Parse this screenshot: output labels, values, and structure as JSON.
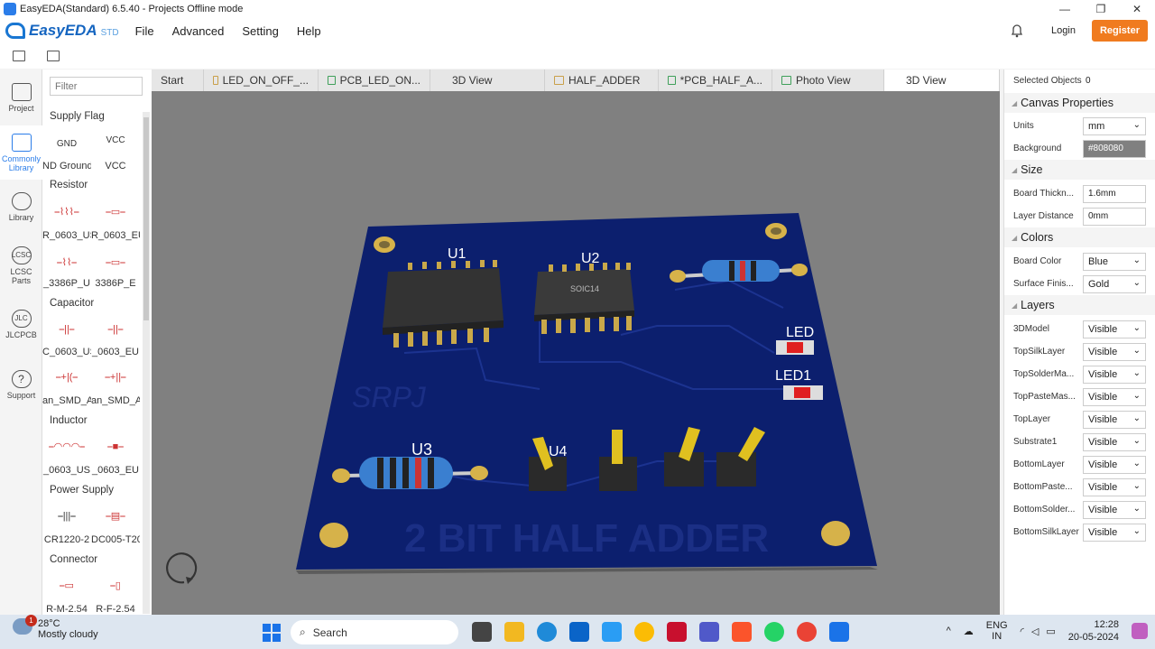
{
  "window": {
    "title": "EasyEDA(Standard) 6.5.40 - Projects Offline mode",
    "min": "—",
    "max": "❐",
    "close": "✕"
  },
  "brand": {
    "name": "EasyEDA",
    "std": "STD"
  },
  "menu": [
    "File",
    "Advanced",
    "Setting",
    "Help"
  ],
  "account": {
    "login": "Login",
    "register": "Register"
  },
  "leftnav": [
    {
      "label": "Project"
    },
    {
      "label": "Commonly Library"
    },
    {
      "label": "Library"
    },
    {
      "label": "LCSC Parts",
      "ic": "LCSC"
    },
    {
      "label": "JLCPCB",
      "ic": "JLC"
    },
    {
      "label": "Support",
      "ic": "?"
    }
  ],
  "library": {
    "filter_placeholder": "Filter",
    "sections": {
      "supply_flag": "Supply Flag",
      "resistor": "Resistor",
      "capacitor": "Capacitor",
      "inductor": "Inductor",
      "power_supply": "Power Supply",
      "connector": "Connector"
    },
    "parts": {
      "gnd_sym": "GND",
      "gnd": "ND Ground",
      "vcc_sym": "VCC",
      "vcc": "VCC",
      "r_us": "R_0603_US",
      "r_eu": "R_0603_EU",
      "pot_us": "_3386P_U",
      "pot_eu": "3386P_E",
      "c_us": "C_0603_US",
      "c_eu": "_0603_EU",
      "cp_us": "an_SMD_A",
      "cp_eu": "an_SMD_A",
      "l_us": "_0603_US",
      "l_eu": "_0603_EU",
      "bat": "CR1220-2",
      "dc": "DC005-T20",
      "conn_m": "R-M-2.54",
      "conn_f": "R-F-2.54"
    }
  },
  "tabs": [
    {
      "label": "Start",
      "kind": "none"
    },
    {
      "label": "LED_ON_OFF_...",
      "kind": "folder"
    },
    {
      "label": "PCB_LED_ON...",
      "kind": "pcb"
    },
    {
      "label": "3D View",
      "kind": "none"
    },
    {
      "label": "HALF_ADDER",
      "kind": "folder"
    },
    {
      "label": "*PCB_HALF_A...",
      "kind": "pcb"
    },
    {
      "label": "Photo View",
      "kind": "pcb"
    },
    {
      "label": "3D View",
      "kind": "none",
      "active": true
    }
  ],
  "board": {
    "silk_u1": "U1",
    "silk_u2": "U2",
    "silk_u3": "U3",
    "silk_u4": "U4",
    "silk_led": "LED",
    "silk_led1": "LED1",
    "chip_u2": "SOIC14",
    "watermark": "SRPJ",
    "title_text": "2 BIT HALF ADDER",
    "color_board": "#0c1f6e",
    "color_pad": "#d6b24a"
  },
  "properties": {
    "selected_label": "Selected Objects",
    "selected_count": "0",
    "canvas_head": "Canvas Properties",
    "units_label": "Units",
    "units_value": "mm",
    "background_label": "Background",
    "background_value": "#808080",
    "size_head": "Size",
    "thickness_label": "Board Thickn...",
    "thickness_value": "1.6mm",
    "layer_dist_label": "Layer Distance",
    "layer_dist_value": "0mm",
    "colors_head": "Colors",
    "board_color_label": "Board Color",
    "board_color_value": "Blue",
    "surface_label": "Surface Finis...",
    "surface_value": "Gold",
    "layers_head": "Layers",
    "layers": [
      {
        "name": "3DModel",
        "value": "Visible"
      },
      {
        "name": "TopSilkLayer",
        "value": "Visible"
      },
      {
        "name": "TopSolderMa...",
        "value": "Visible"
      },
      {
        "name": "TopPasteMas...",
        "value": "Visible"
      },
      {
        "name": "TopLayer",
        "value": "Visible"
      },
      {
        "name": "Substrate1",
        "value": "Visible"
      },
      {
        "name": "BottomLayer",
        "value": "Visible"
      },
      {
        "name": "BottomPaste...",
        "value": "Visible"
      },
      {
        "name": "BottomSolder...",
        "value": "Visible"
      },
      {
        "name": "BottomSilkLayer",
        "value": "Visible"
      }
    ]
  },
  "taskbar": {
    "temp": "28°C",
    "weather": "Mostly cloudy",
    "badge": "1",
    "search": "Search",
    "lang1": "ENG",
    "lang2": "IN",
    "time": "12:28",
    "date": "20-05-2024"
  }
}
